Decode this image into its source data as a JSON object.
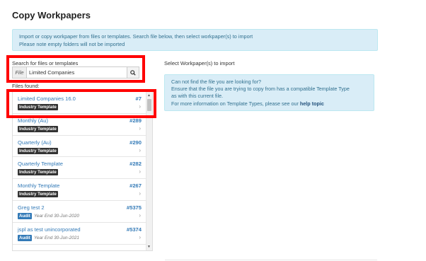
{
  "page": {
    "title": "Copy Workpapers"
  },
  "info_banner": {
    "line1": "Import or copy workpaper from files or templates. Search file below, then select workpaper(s) to import",
    "line2": "Please note empty folders will not be imported"
  },
  "search": {
    "label": "Search for files or templates",
    "addon": "File",
    "value": "Limited Companies",
    "button_icon": "search-icon"
  },
  "files_found_label": "Files found:",
  "files": [
    {
      "name": "Limited Companies 16.0",
      "number": "#7",
      "badge": "Industry Template",
      "badge_type": "industry",
      "year": ""
    },
    {
      "name": "Monthly (Au)",
      "number": "#289",
      "badge": "Industry Template",
      "badge_type": "industry",
      "year": ""
    },
    {
      "name": "Quarterly (Au)",
      "number": "#290",
      "badge": "Industry Template",
      "badge_type": "industry",
      "year": ""
    },
    {
      "name": "Quarterly Template",
      "number": "#282",
      "badge": "Industry Template",
      "badge_type": "industry",
      "year": ""
    },
    {
      "name": "Monthly Template",
      "number": "#267",
      "badge": "Industry Template",
      "badge_type": "industry",
      "year": ""
    },
    {
      "name": "Greg test 2",
      "number": "#5375",
      "badge": "Audit",
      "badge_type": "audit",
      "year": "Year End 30-Jun-2020"
    },
    {
      "name": "jspl as test unincorporated",
      "number": "#5374",
      "badge": "Audit",
      "badge_type": "audit",
      "year": "Year End 30-Jun-2021"
    },
    {
      "name": "",
      "number": "",
      "badge": "",
      "badge_type": "",
      "year": ""
    }
  ],
  "select_label": "Select Workpaper(s) to import",
  "help": {
    "line1": "Can not find the file you are looking for?",
    "line2": "Ensure that the file you are trying to copy from has a compatible Template Type",
    "line3": "as with this current file.",
    "line4_prefix": "For more information on Template Types, please see our",
    "link": "help topic"
  },
  "colors": {
    "accent": "#337ab7",
    "highlight": "#ff0000",
    "info_bg": "#d9edf7"
  }
}
